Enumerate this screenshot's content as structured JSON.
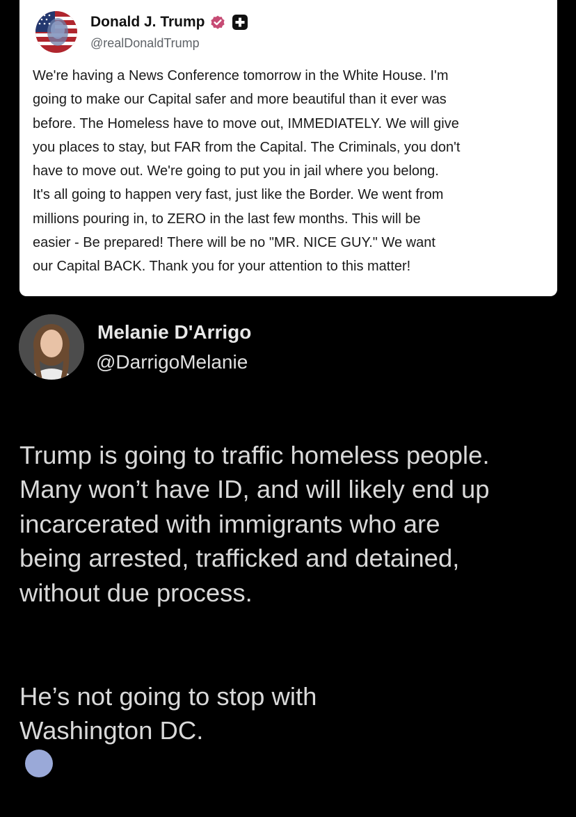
{
  "quoted_post": {
    "author_name": "Donald J. Trump",
    "author_handle": "@realDonaldTrump",
    "verified_icon": "verified-badge-icon",
    "subscribe_icon": "plus-icon",
    "text": "We're having a News Conference tomorrow in the White House. I'm\ngoing to make our Capital safer and more beautiful than it ever was\nbefore. The Homeless have to move out, IMMEDIATELY. We will give\nyou places to stay, but FAR from the Capital. The Criminals, you don't\nhave to move out. We're going to put you in jail where you belong.\nIt's all going to happen very fast, just like the Border. We went from\nmillions pouring in, to ZERO in the  last few months. This will be\neasier - Be prepared! There will be no \"MR. NICE GUY.\" We want\nour Capital BACK. Thank you for your attention to this matter!",
    "badge_color": "#c64b74"
  },
  "post": {
    "author_name": "Melanie D'Arrigo",
    "author_handle": "@DarrigoMelanie",
    "paragraphs": [
      "Trump is going to traffic homeless people.\nMany won’t have ID, and will likely end up\nincarcerated with immigrants who are\nbeing arrested, trafficked and detained,\nwithout due process.",
      "He’s not going to stop with\nWashington DC."
    ]
  },
  "theme": {
    "background": "#000000",
    "card": "#ffffff"
  }
}
